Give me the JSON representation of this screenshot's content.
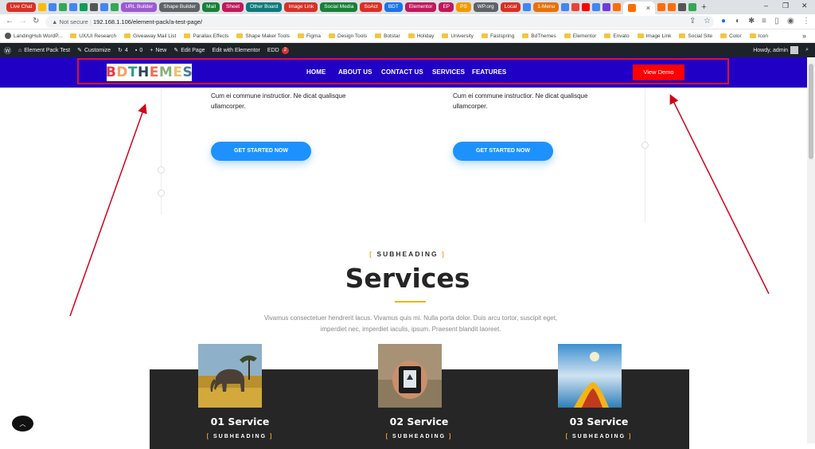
{
  "browser": {
    "tabs": [
      {
        "label": "Live Chat",
        "color": "#d93025"
      },
      {
        "label": "URL Builder",
        "color": "#9c59d1"
      },
      {
        "label": "Shape Builder",
        "color": "#5f6368"
      },
      {
        "label": "Mail",
        "color": "#188038"
      },
      {
        "label": "Sheet",
        "color": "#c2185b"
      },
      {
        "label": "Other Board",
        "color": "#0b7a7a"
      },
      {
        "label": "Image Link",
        "color": "#d93025"
      },
      {
        "label": "Social Media",
        "color": "#188038"
      },
      {
        "label": "SoAct",
        "color": "#d93025"
      },
      {
        "label": "BDT",
        "color": "#1a73e8"
      },
      {
        "label": "Elementor",
        "color": "#c2185b"
      },
      {
        "label": "EP",
        "color": "#c2185b"
      },
      {
        "label": "PS",
        "color": "#f29900"
      },
      {
        "label": "WP.org",
        "color": "#5f6368"
      },
      {
        "label": "Local",
        "color": "#d93025"
      },
      {
        "label": "1-Menu",
        "color": "#e8710a"
      }
    ],
    "close_glyph": "×",
    "new_tab_glyph": "+",
    "window_controls": [
      "–",
      "❐",
      "✕"
    ],
    "url_security": "Not secure",
    "url": "192.168.1.106/element-pack/a-test-page/",
    "bookmarks": [
      "LandingHub WordP...",
      "UX/UI Research",
      "Giveaway Mail List",
      "Parallax Effects",
      "Shape Maker Tools",
      "Figma",
      "Design Tools",
      "Botstar",
      "Holiday",
      "University",
      "Fastspring",
      "BdThemes",
      "Elementor",
      "Envato",
      "Image Link",
      "Social Site",
      "Color",
      "Icon"
    ],
    "bookmarks_more": "»"
  },
  "wp_admin_bar": {
    "site_name": "Element Pack Test",
    "customize": "Customize",
    "updates_count": "4",
    "comments_count": "0",
    "new": "New",
    "edit_page": "Edit Page",
    "edit_elementor": "Edit with Elementor",
    "edd": "EDD",
    "edd_badge": "2",
    "howdy": "Howdy, admin"
  },
  "site": {
    "logo_text": "BDTHEMES",
    "logo_colors": [
      "#e63946",
      "#f4a261",
      "#2a9d8f",
      "#264653",
      "#e76f51",
      "#8ab17d",
      "#e9c46a",
      "#457b9d"
    ],
    "nav": [
      "HOME",
      "ABOUT US",
      "CONTACT US",
      "SERVICES",
      "FEATURES"
    ],
    "cta_label": "View Demo",
    "highlight_color": "#e8101a"
  },
  "content": {
    "left_para": "Cum ei commune instructior. Ne dicat qualisque ullamcorper.",
    "right_para": "Cum ei commune instructior. Ne dicat qualisque ullamcorper.",
    "get_started": "GET STARTED NOW",
    "subheading": "SUBHEADING",
    "services_title": "Services",
    "description": "Vivamus consectetuer hendrerit lacus. Vivamus quis mi. Nulla porta dolor. Duis arcu tortor, suscipit eget, imperdiet nec, imperdiet iaculis, ipsum. Praesent blandit laoreet.",
    "cards": [
      {
        "title": "01 Service",
        "subheading": "SUBHEADING",
        "image": "elephant-savanna"
      },
      {
        "title": "02 Service",
        "subheading": "SUBHEADING",
        "image": "camera-in-hands"
      },
      {
        "title": "03 Service",
        "subheading": "SUBHEADING",
        "image": "kayak-sea"
      }
    ]
  },
  "annotation_color": "#d0021b"
}
